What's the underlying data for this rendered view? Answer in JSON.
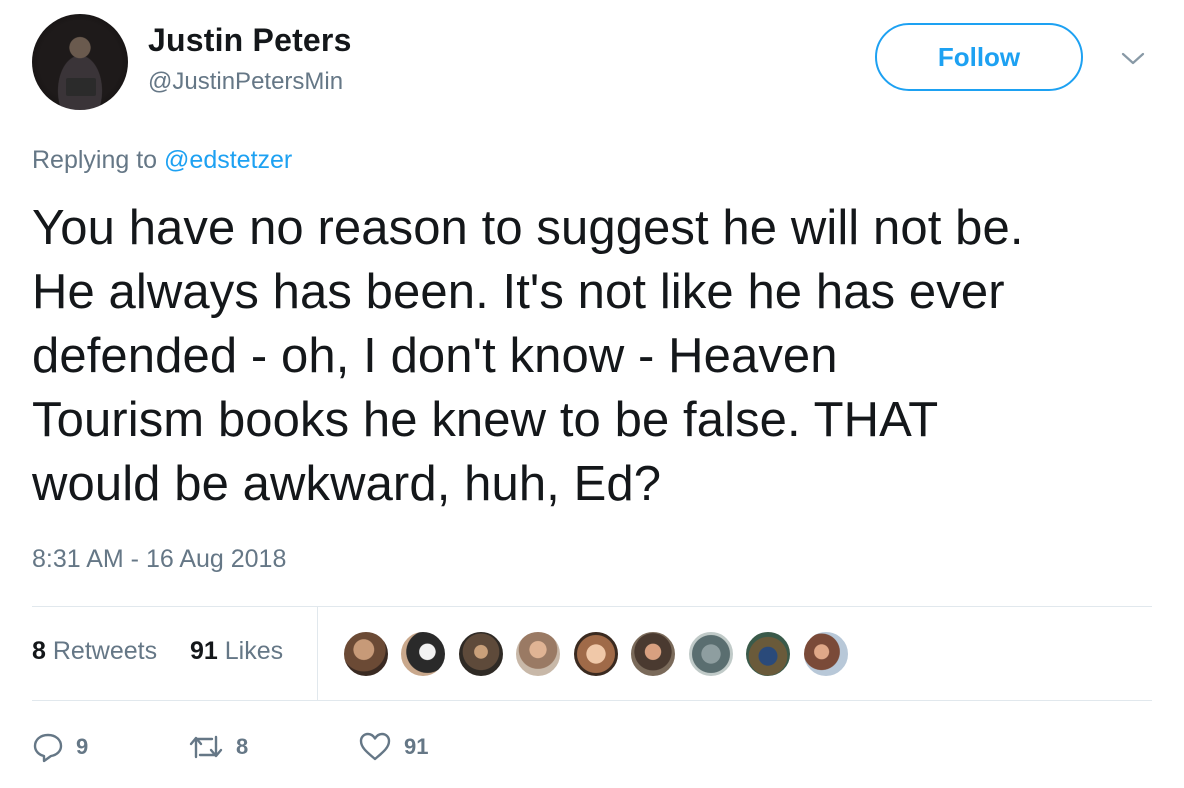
{
  "user": {
    "name": "Justin Peters",
    "handle": "@JustinPetersMin",
    "follow_label": "Follow"
  },
  "reply": {
    "prefix": "Replying to",
    "mention": "@edstetzer"
  },
  "tweet": {
    "lines": [
      "You have no reason to suggest he will not be.",
      "He always has been. It's not like he has ever",
      "defended - oh, I don't know - Heaven",
      "Tourism books he knew to be false. THAT",
      "would be awkward, huh, Ed?"
    ],
    "timestamp": "8:31 AM - 16 Aug 2018"
  },
  "stats": {
    "retweets_count": "8",
    "retweets_label": "Retweets",
    "likes_count": "91",
    "likes_label": "Likes"
  },
  "actions": {
    "reply_count": "9",
    "retweet_count": "8",
    "like_count": "91"
  },
  "colors": {
    "accent": "#1da1f2",
    "muted": "#657786",
    "text": "#14171a",
    "divider": "#e1e8ed"
  },
  "likers": [
    {
      "name": "liker-avatar-1",
      "icon": "user-photo"
    },
    {
      "name": "liker-avatar-2",
      "icon": "user-photo"
    },
    {
      "name": "liker-avatar-3",
      "icon": "user-photo"
    },
    {
      "name": "liker-avatar-4",
      "icon": "user-photo"
    },
    {
      "name": "liker-avatar-5",
      "icon": "user-photo"
    },
    {
      "name": "liker-avatar-6",
      "icon": "user-photo"
    },
    {
      "name": "liker-avatar-7",
      "icon": "user-photo"
    },
    {
      "name": "liker-avatar-8",
      "icon": "user-photo"
    },
    {
      "name": "liker-avatar-9",
      "icon": "user-photo"
    }
  ]
}
